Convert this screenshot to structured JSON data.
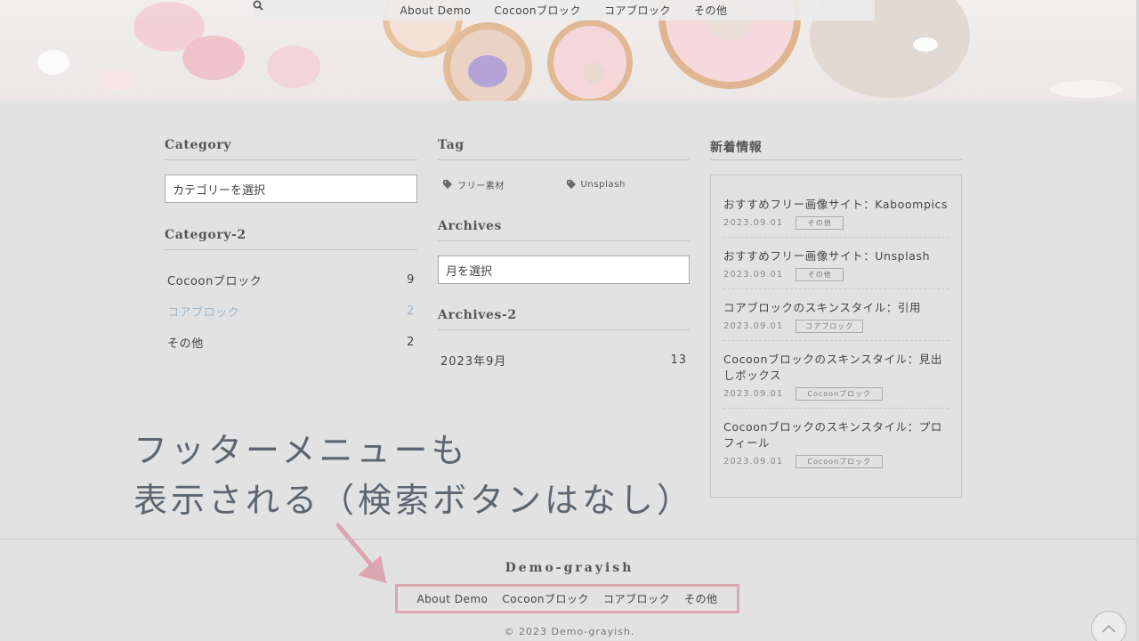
{
  "header": {
    "nav": [
      "About Demo",
      "Cocoonブロック",
      "コアブロック",
      "その他"
    ],
    "search_icon": "search-icon"
  },
  "widgets": {
    "category": {
      "title": "Category",
      "select_value": "カテゴリーを選択"
    },
    "category2": {
      "title": "Category-2",
      "items": [
        {
          "label": "Cocoonブロック",
          "count": "9"
        },
        {
          "label": "コアブロック",
          "count": "2"
        },
        {
          "label": "その他",
          "count": "2"
        }
      ]
    },
    "tag": {
      "title": "Tag",
      "items": [
        "フリー素材",
        "Unsplash"
      ]
    },
    "archives": {
      "title": "Archives",
      "select_value": "月を選択"
    },
    "archives2": {
      "title": "Archives-2",
      "items": [
        {
          "label": "2023年9月",
          "count": "13"
        }
      ]
    },
    "news": {
      "title": "新着情報",
      "items": [
        {
          "title": "おすすめフリー画像サイト：Kaboompics",
          "date": "2023.09.01",
          "category": "その他"
        },
        {
          "title": "おすすめフリー画像サイト：Unsplash",
          "date": "2023.09.01",
          "category": "その他"
        },
        {
          "title": "コアブロックのスキンスタイル：引用",
          "date": "2023.09.01",
          "category": "コアブロック"
        },
        {
          "title": "Cocoonブロックのスキンスタイル：見出しボックス",
          "date": "2023.09.01",
          "category": "Cocoonブロック"
        },
        {
          "title": "Cocoonブロックのスキンスタイル：プロフィール",
          "date": "2023.09.01",
          "category": "Cocoonブロック"
        }
      ]
    }
  },
  "annotation": {
    "line1": "フッターメニューも",
    "line2": "表示される（検索ボタンはなし）"
  },
  "footer": {
    "brand": "Demo-grayish",
    "nav": [
      "About Demo",
      "Cocoonブロック",
      "コアブロック",
      "その他"
    ],
    "copyright": "© 2023 Demo-grayish."
  },
  "colors": {
    "accent_link": "#9fb5c8",
    "highlight_border": "#d9a7b2",
    "arrow": "#dca5b1"
  }
}
